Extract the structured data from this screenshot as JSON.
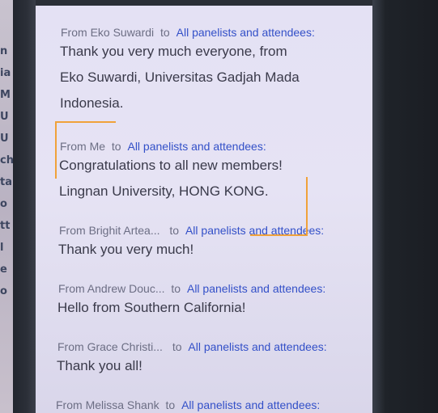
{
  "background": {
    "left_strip_letters": [
      "n",
      "ia",
      "M",
      "U",
      "U",
      "ch",
      "ta",
      "o",
      "tt",
      "l",
      "e",
      "o"
    ]
  },
  "chat": {
    "messages": [
      {
        "from_prefix": "From",
        "sender": "Eko Suwardi",
        "to_label": "to",
        "recipient": "All panelists and attendees:",
        "lines": [
          "Thank you very much everyone,  from",
          "Eko Suwardi, Universitas Gadjah Mada",
          "Indonesia."
        ]
      },
      {
        "from_prefix": "From",
        "sender": "Me",
        "to_label": "to",
        "recipient": "All panelists and attendees:",
        "lines": [
          "Congratulations to all new members!",
          "Lingnan University, HONG KONG."
        ]
      },
      {
        "from_prefix": "From",
        "sender": "Brighit Artea...",
        "to_label": "to",
        "recipient": "All panelists and attendees:",
        "lines": [
          "Thank you very much!"
        ]
      },
      {
        "from_prefix": "From",
        "sender": "Andrew Douc...",
        "to_label": "to",
        "recipient": "All panelists and attendees:",
        "lines": [
          "Hello from Southern California!"
        ]
      },
      {
        "from_prefix": "From",
        "sender": "Grace Christi...",
        "to_label": "to",
        "recipient": "All panelists and attendees:",
        "lines": [
          "Thank you all!"
        ]
      },
      {
        "from_prefix": "From",
        "sender": "Melissa Shank",
        "to_label": "to",
        "recipient": "All panelists and attendees:",
        "lines": []
      }
    ]
  },
  "colors": {
    "recipient_link": "#3350c8",
    "annotation": "#f0a23a",
    "panel_bg": "#e4e1f4"
  }
}
